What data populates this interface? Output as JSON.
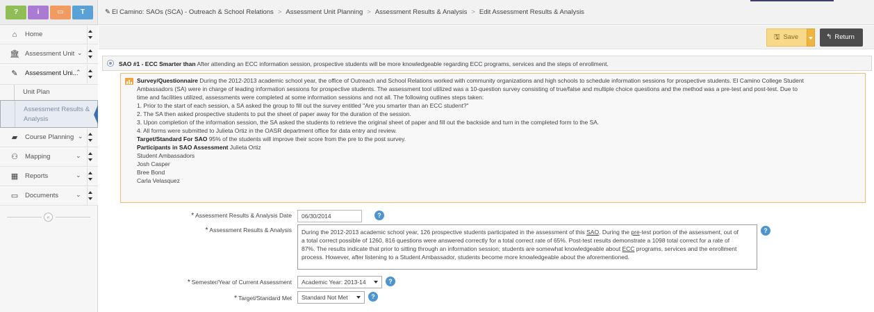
{
  "quick_buttons": [
    {
      "icon": "question-icon",
      "glyph": "?",
      "color": "#8fbd56"
    },
    {
      "icon": "info-icon",
      "glyph": "i",
      "color": "#ab7ad3"
    },
    {
      "icon": "window-icon",
      "glyph": "▭",
      "color": "#f19a61"
    },
    {
      "icon": "filter-icon",
      "glyph": "T",
      "color": "#5aa2d6"
    }
  ],
  "breadcrumb": {
    "items": [
      "El Camino: SAOs (SCA) - Outreach & School Relations",
      "Assessment Unit Planning",
      "Assessment Results & Analysis",
      "Edit Assessment Results & Analysis"
    ],
    "separator": ">"
  },
  "sidebar": {
    "items": [
      {
        "name": "home",
        "label": "Home",
        "icon": "home-icon"
      },
      {
        "name": "assessment-unit",
        "label": "Assessment Unit",
        "icon": "institution-icon"
      },
      {
        "name": "assessment-unit-planning",
        "label": "Assessment Uni...",
        "icon": "pencil-icon"
      },
      {
        "name": "course-planning",
        "label": "Course Planning",
        "icon": "book-icon"
      },
      {
        "name": "mapping",
        "label": "Mapping",
        "icon": "sitemap-icon"
      },
      {
        "name": "reports",
        "label": "Reports",
        "icon": "table-icon"
      },
      {
        "name": "documents",
        "label": "Documents",
        "icon": "folder-icon"
      }
    ],
    "sub_items": [
      {
        "label": "Unit Plan",
        "selected": false
      },
      {
        "label": "Assessment Results & Analysis",
        "label_line1": "Assessment Results &",
        "label_line2": "Analysis",
        "selected": true
      }
    ]
  },
  "toolbar": {
    "save_label": "Save",
    "return_label": "Return",
    "save_color": "#f8d98a",
    "return_color": "#4c4c4c"
  },
  "sao": {
    "code": "SAO #1 - ECC Smarter than",
    "description": "After attending an ECC information session, prospective students will be more knowledgeable regarding ECC programs, services and the steps of enrollment."
  },
  "assessment": {
    "method_label": "Survey/Questionnaire",
    "lines": [
      "During the 2012-2013 academic school year, the office of Outreach and School Relations worked with community organizations and high schools to schedule information sessions for prospective students. El Camino College Student",
      "Ambassadors (SA) were in charge of leading information sessions for prospective students. The assessment tool utilized was a 10-question survey consisting of true/false and multiple choice questions and the method was a pre-test and post-test. Due to",
      "time and facilities utilized, assessments were completed at some information sessions and not all. The following outlines steps taken:",
      "1. Prior to the start of each session, a SA asked the group to fill out the survey entitled \"Are you smarter than an ECC student?\"",
      "2. The SA then asked prospective students to put the sheet of paper away for the duration of the session.",
      "3. Upon completion of the information session, the SA asked the students to retrieve the original sheet of paper and fill out the backside and turn in the completed form to the SA.",
      "4. All forms were submitted to Julieta Ortiz in the OASR department office for data entry and review."
    ],
    "target_label": "Target/Standard For SAO",
    "target_text": "95% of the students will improve their score from the pre to the post survey.",
    "participants_label": "Participants in SAO Assessment",
    "participants": [
      "Julieta Ortiz",
      "Student Ambassadors",
      "Josh Casper",
      "Bree Bond",
      "Carla Velasquez"
    ]
  },
  "form": {
    "date_label": "Assessment Results & Analysis Date",
    "date_value": "06/30/2014",
    "results_label": "Assessment Results & Analysis",
    "results_lines": [
      "During the 2012-2013 academic school year, 126 prospective students participated in the assessment of this SAO. During the pre-test portion of the assessment, out of",
      "a total correct possible of 1260, 816 questions were answered correctly for a total correct rate of 65%. Post-test results demonstrate a 1098 total correct for a rate of",
      "87%. The results indicate that prior to sitting through an information session; students are somewhat knowledgeable about ECC programs, services and the enrollment",
      "process. However, after listening to a Student Ambassador, students become more knowledgeable about the aforementioned."
    ],
    "semester_label": "Semester/Year of Current Assessment",
    "semester_value": "Academic Year: 2013-14",
    "target_met_label": "Target/Standard Met",
    "target_met_value": "Standard Not Met",
    "required_mark": "*",
    "help_glyph": "?"
  }
}
